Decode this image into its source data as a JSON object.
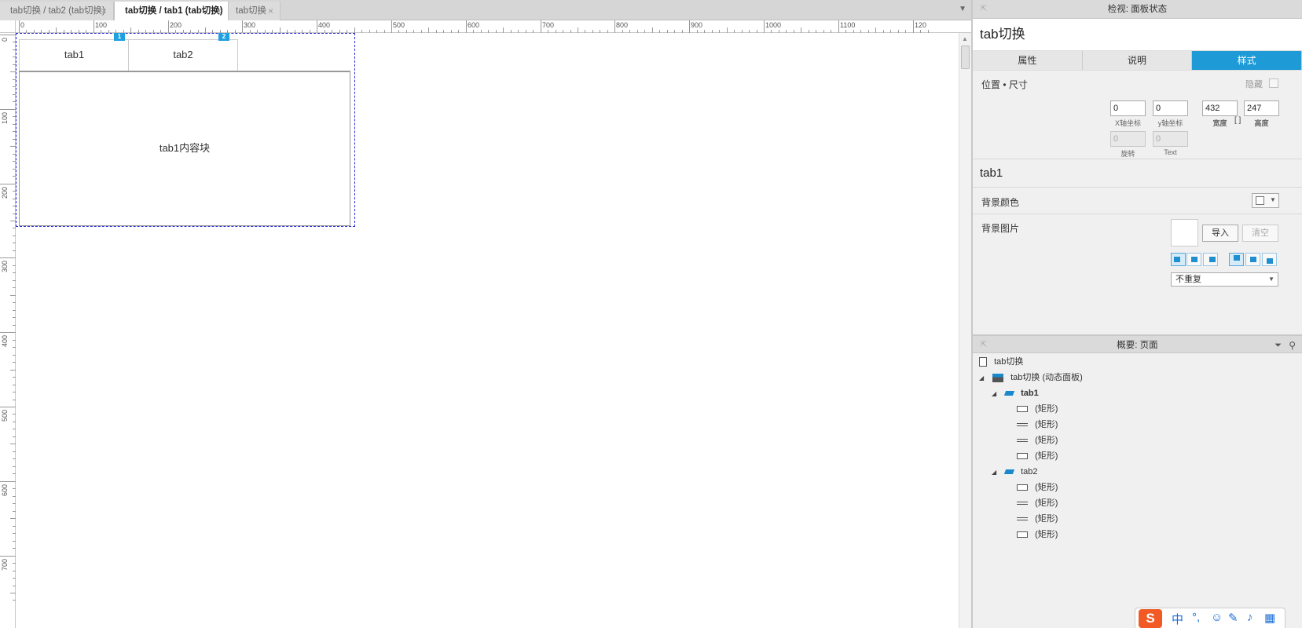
{
  "doc_tabs": [
    {
      "label": "tab切换 / tab2 (tab切换)",
      "active": false
    },
    {
      "label": "tab切换 / tab1 (tab切换)",
      "active": true
    },
    {
      "label": "tab切换",
      "active": false
    }
  ],
  "close_glyph": "×",
  "ruler": {
    "h_labels": [
      "0",
      "100",
      "200",
      "300",
      "400",
      "500",
      "600",
      "700",
      "800",
      "900",
      "1000",
      "1100",
      "120"
    ],
    "v_labels": [
      "0",
      "100",
      "200",
      "300",
      "400",
      "500",
      "600",
      "700"
    ]
  },
  "canvas": {
    "tab1_label": "tab1",
    "tab2_label": "tab2",
    "content_label": "tab1内容块",
    "marker1": "1",
    "marker2": "2"
  },
  "inspector": {
    "header": "检视: 面板状态",
    "title": "tab切换",
    "tabs": [
      "属性",
      "说明",
      "样式"
    ],
    "selected_tab": "样式",
    "position_size_label": "位置 • 尺寸",
    "hide_label": "隐藏",
    "x_value": "0",
    "y_value": "0",
    "width_value": "432",
    "height_value": "247",
    "x_label": "X轴坐标",
    "y_label": "y轴坐标",
    "width_label": "宽度",
    "height_label": "高度",
    "rotation_value": "0",
    "text_rotation_value": "0",
    "rotation_label": "旋转",
    "text_label": "Text",
    "state_name": "tab1",
    "bg_color_label": "背景颜色",
    "bg_image_label": "背景图片",
    "import_label": "导入",
    "clear_label": "清空",
    "repeat_value": "不重复"
  },
  "outline": {
    "header": "概要: 页面",
    "items": [
      {
        "label": "tab切换",
        "icon": "page",
        "level": 0
      },
      {
        "label": "tab切换 (动态面板)",
        "icon": "dynamic-panel",
        "level": 0
      },
      {
        "label": "tab1",
        "icon": "state",
        "level": 1,
        "bold": true
      },
      {
        "label": "(矩形)",
        "icon": "rect",
        "level": 2
      },
      {
        "label": "(矩形)",
        "icon": "line",
        "level": 2
      },
      {
        "label": "(矩形)",
        "icon": "line",
        "level": 2
      },
      {
        "label": "(矩形)",
        "icon": "rect",
        "level": 2
      },
      {
        "label": "tab2",
        "icon": "state",
        "level": 1
      },
      {
        "label": "(矩形)",
        "icon": "rect",
        "level": 2
      },
      {
        "label": "(矩形)",
        "icon": "line",
        "level": 2
      },
      {
        "label": "(矩形)",
        "icon": "line",
        "level": 2
      },
      {
        "label": "(矩形)",
        "icon": "rect",
        "level": 2
      }
    ]
  },
  "ime": {
    "mode": "中",
    "punct": "°,"
  },
  "colors": {
    "accent": "#1e9ad6",
    "selection": "#2b2bd8"
  }
}
